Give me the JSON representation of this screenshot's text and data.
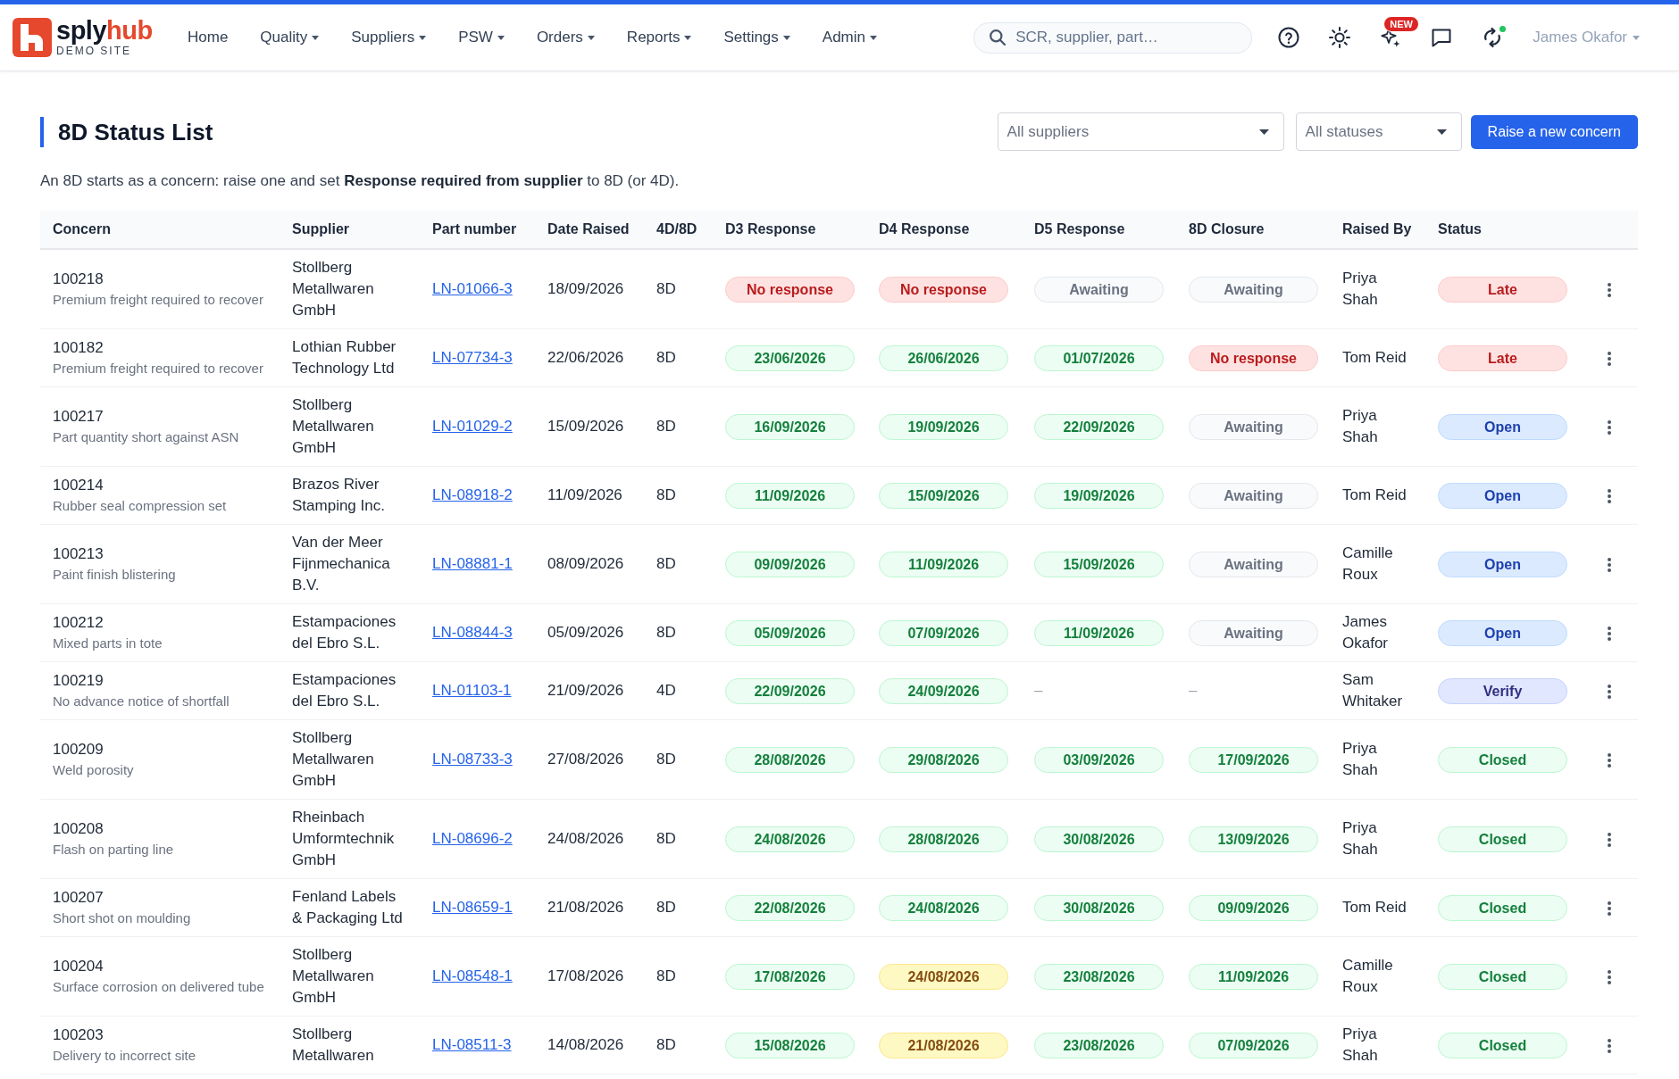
{
  "header": {
    "logo": {
      "wordmark": [
        "sply",
        "hub"
      ],
      "tagline": "DEMO SITE"
    },
    "nav": [
      {
        "label": "Home",
        "dropdown": false
      },
      {
        "label": "Quality",
        "dropdown": true
      },
      {
        "label": "Suppliers",
        "dropdown": true
      },
      {
        "label": "PSW",
        "dropdown": true
      },
      {
        "label": "Orders",
        "dropdown": true
      },
      {
        "label": "Reports",
        "dropdown": true
      },
      {
        "label": "Settings",
        "dropdown": true
      },
      {
        "label": "Admin",
        "dropdown": true
      }
    ],
    "search": {
      "placeholder": "SCR, supplier, part…"
    },
    "new_badge": "NEW",
    "sync_online": true,
    "user": "James Okafor"
  },
  "page": {
    "title": "8D Status List",
    "filters": [
      {
        "value": "All suppliers"
      },
      {
        "value": "All statuses"
      }
    ],
    "action": "Raise a new concern",
    "description": "An 8D starts as a concern: raise one and set **Response required from supplier** to 8D (or 4D)."
  },
  "table": {
    "columns": [
      "Concern",
      "Supplier",
      "Part number",
      "Date Raised",
      "4D/8D",
      "D3 Response",
      "D4 Response",
      "D5 Response",
      "8D Closure",
      "Raised By",
      "Status"
    ],
    "rows": [
      {
        "concern": "100218",
        "title": "Premium freight required to recover",
        "supplier": "Stollberg Metallwaren GmbH",
        "part_number": "LN-01066-3",
        "date_raised": "18/09/2026",
        "type": "8D",
        "d3": {
          "text": "No response",
          "kind": "no_response"
        },
        "d4": {
          "text": "No response",
          "kind": "no_response"
        },
        "d5": {
          "text": "Awaiting",
          "kind": "awaiting"
        },
        "closure": {
          "text": "Awaiting",
          "kind": "awaiting"
        },
        "raised_by": "Priya Shah",
        "status": {
          "text": "Late",
          "kind": "late"
        }
      },
      {
        "concern": "100182",
        "title": "Premium freight required to recover",
        "supplier": "Lothian Rubber Technology Ltd",
        "part_number": "LN-07734-3",
        "date_raised": "22/06/2026",
        "type": "8D",
        "d3": {
          "text": "23/06/2026",
          "kind": "received"
        },
        "d4": {
          "text": "26/06/2026",
          "kind": "received"
        },
        "d5": {
          "text": "01/07/2026",
          "kind": "received"
        },
        "closure": {
          "text": "No response",
          "kind": "no_response"
        },
        "raised_by": "Tom Reid",
        "status": {
          "text": "Late",
          "kind": "late"
        }
      },
      {
        "concern": "100217",
        "title": "Part quantity short against ASN",
        "supplier": "Stollberg Metallwaren GmbH",
        "part_number": "LN-01029-2",
        "date_raised": "15/09/2026",
        "type": "8D",
        "d3": {
          "text": "16/09/2026",
          "kind": "received"
        },
        "d4": {
          "text": "19/09/2026",
          "kind": "received"
        },
        "d5": {
          "text": "22/09/2026",
          "kind": "received"
        },
        "closure": {
          "text": "Awaiting",
          "kind": "awaiting"
        },
        "raised_by": "Priya Shah",
        "status": {
          "text": "Open",
          "kind": "open"
        }
      },
      {
        "concern": "100214",
        "title": "Rubber seal compression set",
        "supplier": "Brazos River Stamping Inc.",
        "part_number": "LN-08918-2",
        "date_raised": "11/09/2026",
        "type": "8D",
        "d3": {
          "text": "11/09/2026",
          "kind": "received"
        },
        "d4": {
          "text": "15/09/2026",
          "kind": "received"
        },
        "d5": {
          "text": "19/09/2026",
          "kind": "received"
        },
        "closure": {
          "text": "Awaiting",
          "kind": "awaiting"
        },
        "raised_by": "Tom Reid",
        "status": {
          "text": "Open",
          "kind": "open"
        }
      },
      {
        "concern": "100213",
        "title": "Paint finish blistering",
        "supplier": "Van der Meer Fijnmechanica B.V.",
        "part_number": "LN-08881-1",
        "date_raised": "08/09/2026",
        "type": "8D",
        "d3": {
          "text": "09/09/2026",
          "kind": "received"
        },
        "d4": {
          "text": "11/09/2026",
          "kind": "received"
        },
        "d5": {
          "text": "15/09/2026",
          "kind": "received"
        },
        "closure": {
          "text": "Awaiting",
          "kind": "awaiting"
        },
        "raised_by": "Camille Roux",
        "status": {
          "text": "Open",
          "kind": "open"
        }
      },
      {
        "concern": "100212",
        "title": "Mixed parts in tote",
        "supplier": "Estampaciones del Ebro S.L.",
        "part_number": "LN-08844-3",
        "date_raised": "05/09/2026",
        "type": "8D",
        "d3": {
          "text": "05/09/2026",
          "kind": "received"
        },
        "d4": {
          "text": "07/09/2026",
          "kind": "received"
        },
        "d5": {
          "text": "11/09/2026",
          "kind": "received"
        },
        "closure": {
          "text": "Awaiting",
          "kind": "awaiting"
        },
        "raised_by": "James Okafor",
        "status": {
          "text": "Open",
          "kind": "open"
        }
      },
      {
        "concern": "100219",
        "title": "No advance notice of shortfall",
        "supplier": "Estampaciones del Ebro S.L.",
        "part_number": "LN-01103-1",
        "date_raised": "21/09/2026",
        "type": "4D",
        "d3": {
          "text": "22/09/2026",
          "kind": "received"
        },
        "d4": {
          "text": "24/09/2026",
          "kind": "received"
        },
        "d5": {
          "text": "–",
          "kind": "none"
        },
        "closure": {
          "text": "–",
          "kind": "none"
        },
        "raised_by": "Sam Whitaker",
        "status": {
          "text": "Verify",
          "kind": "verify"
        }
      },
      {
        "concern": "100209",
        "title": "Weld porosity",
        "supplier": "Stollberg Metallwaren GmbH",
        "part_number": "LN-08733-3",
        "date_raised": "27/08/2026",
        "type": "8D",
        "d3": {
          "text": "28/08/2026",
          "kind": "received"
        },
        "d4": {
          "text": "29/08/2026",
          "kind": "received"
        },
        "d5": {
          "text": "03/09/2026",
          "kind": "received"
        },
        "closure": {
          "text": "17/09/2026",
          "kind": "received"
        },
        "raised_by": "Priya Shah",
        "status": {
          "text": "Closed",
          "kind": "closed"
        }
      },
      {
        "concern": "100208",
        "title": "Flash on parting line",
        "supplier": "Rheinbach Umformtechnik GmbH",
        "part_number": "LN-08696-2",
        "date_raised": "24/08/2026",
        "type": "8D",
        "d3": {
          "text": "24/08/2026",
          "kind": "received"
        },
        "d4": {
          "text": "28/08/2026",
          "kind": "received"
        },
        "d5": {
          "text": "30/08/2026",
          "kind": "received"
        },
        "closure": {
          "text": "13/09/2026",
          "kind": "received"
        },
        "raised_by": "Priya Shah",
        "status": {
          "text": "Closed",
          "kind": "closed"
        }
      },
      {
        "concern": "100207",
        "title": "Short shot on moulding",
        "supplier": "Fenland Labels & Packaging Ltd",
        "part_number": "LN-08659-1",
        "date_raised": "21/08/2026",
        "type": "8D",
        "d3": {
          "text": "22/08/2026",
          "kind": "received"
        },
        "d4": {
          "text": "24/08/2026",
          "kind": "received"
        },
        "d5": {
          "text": "30/08/2026",
          "kind": "received"
        },
        "closure": {
          "text": "09/09/2026",
          "kind": "received"
        },
        "raised_by": "Tom Reid",
        "status": {
          "text": "Closed",
          "kind": "closed"
        }
      },
      {
        "concern": "100204",
        "title": "Surface corrosion on delivered tube",
        "supplier": "Stollberg Metallwaren GmbH",
        "part_number": "LN-08548-1",
        "date_raised": "17/08/2026",
        "type": "8D",
        "d3": {
          "text": "17/08/2026",
          "kind": "received"
        },
        "d4": {
          "text": "24/08/2026",
          "kind": "late_received"
        },
        "d5": {
          "text": "23/08/2026",
          "kind": "received"
        },
        "closure": {
          "text": "11/09/2026",
          "kind": "received"
        },
        "raised_by": "Camille Roux",
        "status": {
          "text": "Closed",
          "kind": "closed"
        }
      },
      {
        "concern": "100203",
        "title": "Delivery to incorrect site",
        "supplier": "Stollberg Metallwaren",
        "part_number": "LN-08511-3",
        "date_raised": "14/08/2026",
        "type": "8D",
        "d3": {
          "text": "15/08/2026",
          "kind": "received"
        },
        "d4": {
          "text": "21/08/2026",
          "kind": "late_received"
        },
        "d5": {
          "text": "23/08/2026",
          "kind": "received"
        },
        "closure": {
          "text": "07/09/2026",
          "kind": "received"
        },
        "raised_by": "Priya Shah",
        "status": {
          "text": "Closed",
          "kind": "closed"
        }
      }
    ]
  }
}
